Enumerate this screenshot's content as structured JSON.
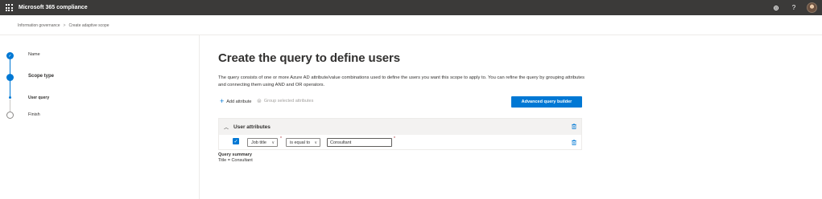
{
  "app": {
    "title": "Microsoft 365 compliance"
  },
  "topbar": {
    "settings_icon": "gear-icon",
    "help_label": "?",
    "waffle_icon": "app-launcher-icon"
  },
  "breadcrumb": {
    "items": [
      "Information governance",
      "Create adaptive scope"
    ],
    "separator": ">"
  },
  "steps": [
    {
      "label": "Name",
      "state": "completed"
    },
    {
      "label": "Scope type",
      "state": "current"
    },
    {
      "label": "User query",
      "state": "current-substep"
    },
    {
      "label": "Finish",
      "state": "not-started"
    }
  ],
  "main": {
    "heading": "Create the query to define users",
    "description": "The query consists of one or more Azure AD attribute/value combinations used to define the users you want this scope to apply to. You can refine the query by grouping attributes and connecting them using AND and OR operators."
  },
  "toolbar": {
    "add_attribute": "Add attribute",
    "group_attributes": "Group selected attributes",
    "advanced_builder": "Advanced query builder"
  },
  "panel": {
    "title": "User attributes",
    "rows": [
      {
        "attribute": "Job title",
        "operator": "is equal to",
        "value": "Consultant",
        "checked": true
      }
    ]
  },
  "summary": {
    "title": "Query summary",
    "text": "Title = Consultant"
  },
  "colors": {
    "accent": "#0078d4",
    "topbar": "#3b3a39"
  }
}
